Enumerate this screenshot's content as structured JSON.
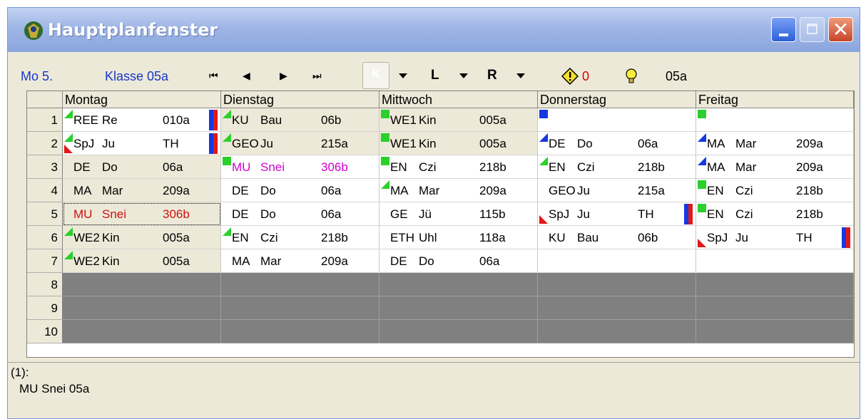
{
  "window": {
    "title": "Hauptplanfenster"
  },
  "toolbar": {
    "day": "Mo 5.",
    "class_label": "Klasse 05a",
    "nav": {
      "first": "⏮",
      "prev": "◀",
      "next": "▶",
      "last": "⏭"
    },
    "k_label": "K",
    "l_label": "L",
    "r_label": "R",
    "warning_count": "0",
    "class_short": "05a",
    "colors": {
      "accent": "#1a36c8",
      "warning": "#e00000"
    }
  },
  "grid": {
    "days": [
      "Montag",
      "Dienstag",
      "Mittwoch",
      "Donnerstag",
      "Freitag"
    ],
    "periods": [
      "1",
      "2",
      "3",
      "4",
      "5",
      "6",
      "7",
      "8",
      "9",
      "10"
    ],
    "cells": [
      [
        [
          "REE",
          "Re",
          "010a"
        ],
        [
          "SpJ",
          "Ju",
          "TH"
        ],
        [
          "DE",
          "Do",
          "06a"
        ],
        [
          "MA",
          "Mar",
          "209a"
        ],
        [
          "MU",
          "Snei",
          "306b"
        ],
        [
          "WE2",
          "Kin",
          "005a"
        ],
        [
          "WE2",
          "Kin",
          "005a"
        ]
      ],
      [
        [
          "KU",
          "Bau",
          "06b"
        ],
        [
          "GEO",
          "Ju",
          "215a"
        ],
        [
          "MU",
          "Snei",
          "306b"
        ],
        [
          "DE",
          "Do",
          "06a"
        ],
        [
          "DE",
          "Do",
          "06a"
        ],
        [
          "EN",
          "Czi",
          "218b"
        ],
        [
          "MA",
          "Mar",
          "209a"
        ]
      ],
      [
        [
          "WE1",
          "Kin",
          "005a"
        ],
        [
          "WE1",
          "Kin",
          "005a"
        ],
        [
          "EN",
          "Czi",
          "218b"
        ],
        [
          "MA",
          "Mar",
          "209a"
        ],
        [
          "GE",
          "Jü",
          "115b"
        ],
        [
          "ETH",
          "Uhl",
          "118a"
        ],
        [
          "DE",
          "Do",
          "06a"
        ]
      ],
      [
        [
          "",
          "",
          ""
        ],
        [
          "DE",
          "Do",
          "06a"
        ],
        [
          "EN",
          "Czi",
          "218b"
        ],
        [
          "GEO",
          "Ju",
          "215a"
        ],
        [
          "SpJ",
          "Ju",
          "TH"
        ],
        [
          "KU",
          "Bau",
          "06b"
        ],
        [
          "",
          "",
          ""
        ]
      ],
      [
        [
          "",
          "",
          ""
        ],
        [
          "MA",
          "Mar",
          "209a"
        ],
        [
          "MA",
          "Mar",
          "209a"
        ],
        [
          "EN",
          "Czi",
          "218b"
        ],
        [
          "EN",
          "Czi",
          "218b"
        ],
        [
          "SpJ",
          "Ju",
          "TH"
        ],
        [
          "",
          "",
          ""
        ]
      ]
    ]
  },
  "footer": {
    "line1": "(1):",
    "line2": "MU Snei 05a"
  }
}
